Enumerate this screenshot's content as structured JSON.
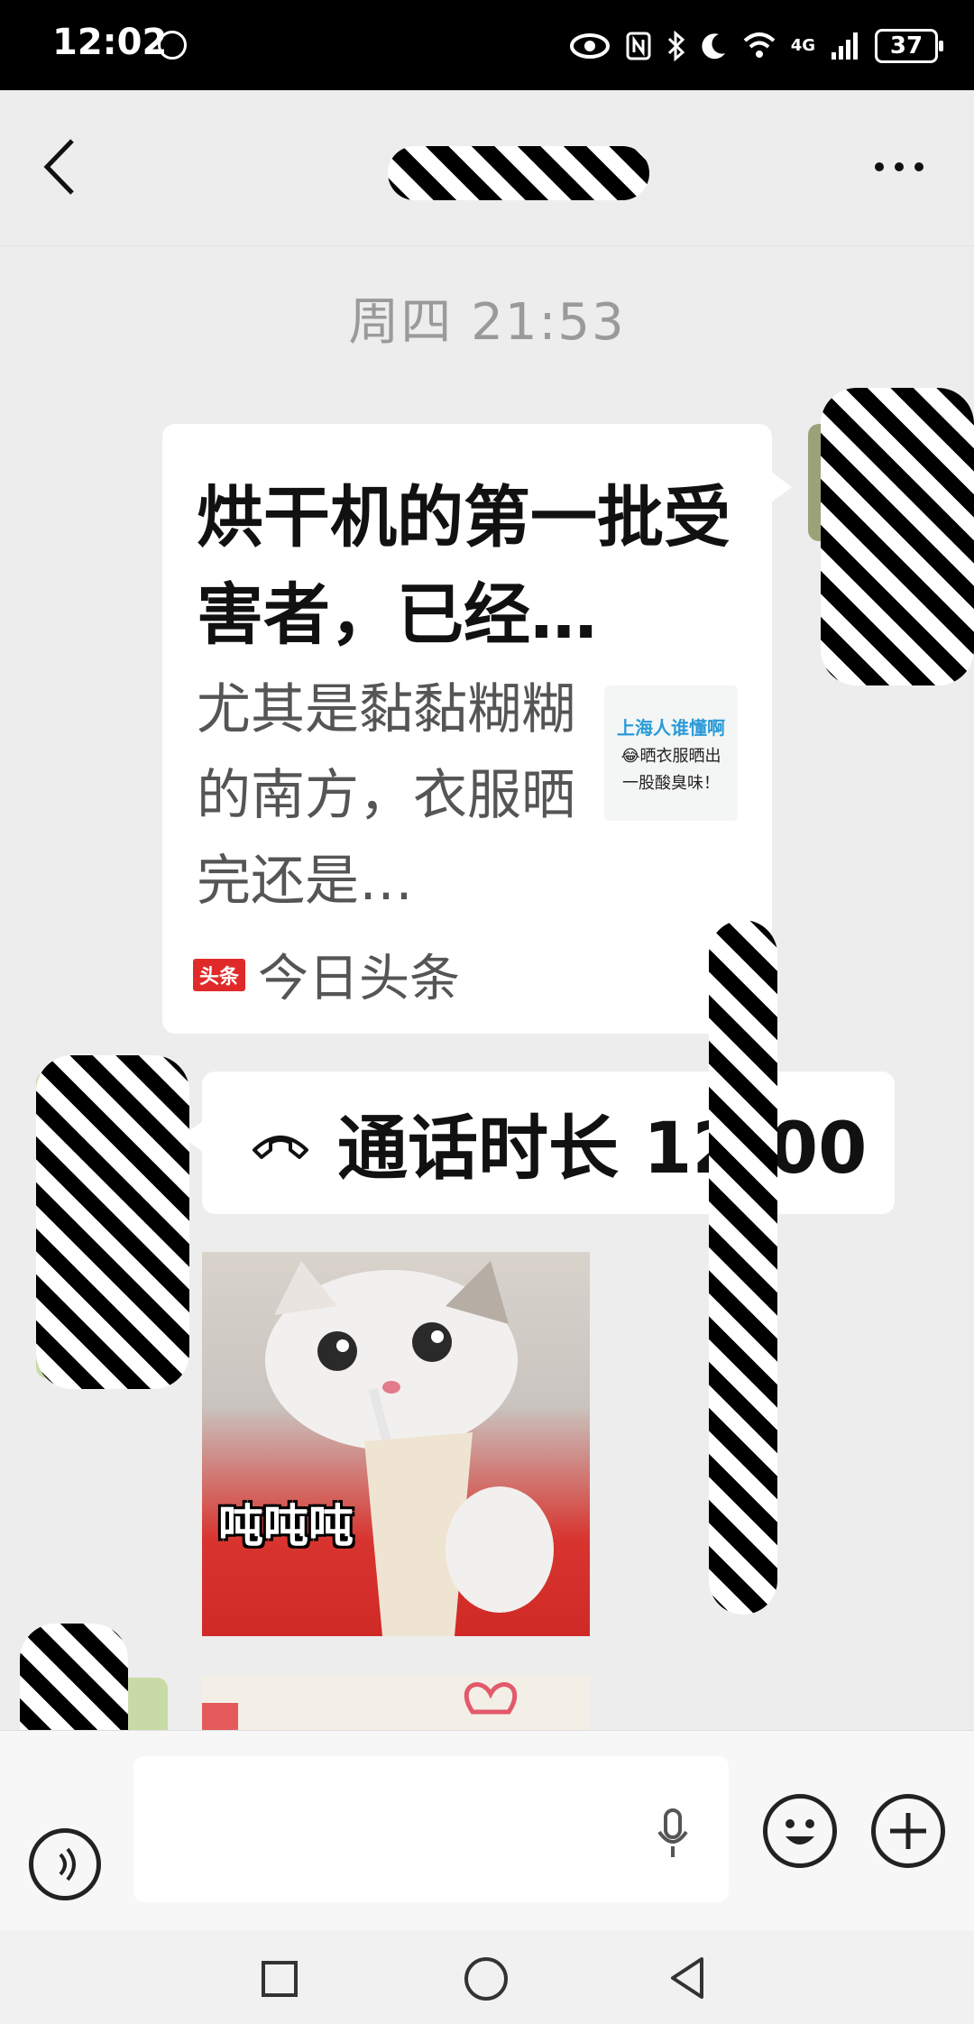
{
  "status_bar": {
    "time": "12:02",
    "network": "4G",
    "battery": "37"
  },
  "chat": {
    "timestamp": "周四 21:53"
  },
  "link_card": {
    "title": "烘干机的第一批受害者，已经…",
    "description": "尤其是黏黏糊糊的南方，衣服晒完还是…",
    "thumb_line1": "上海人谁懂啊",
    "thumb_line2": "😂晒衣服晒出",
    "thumb_line3": "一股酸臭味！",
    "source_badge": "头条",
    "source_name": "今日头条"
  },
  "call_bubble": {
    "text": "通话时长 12:00"
  },
  "sticker": {
    "caption": "吨吨吨"
  },
  "icons": {
    "back": "chevron-left-icon",
    "more": "more-icon",
    "call": "phone-hangup-icon",
    "voice": "voice-icon",
    "mic": "microphone-icon",
    "emoji": "emoji-icon",
    "plus": "plus-icon"
  }
}
